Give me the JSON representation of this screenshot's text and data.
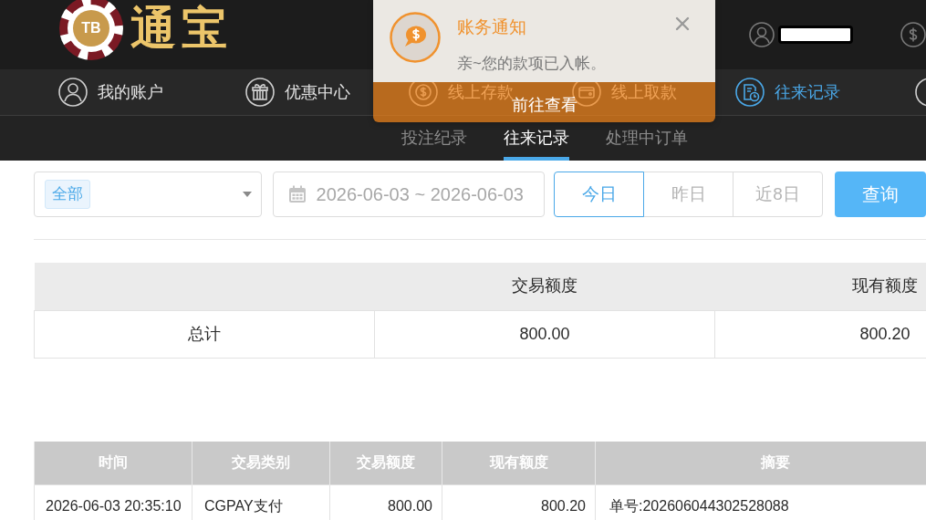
{
  "header": {
    "logo": {
      "badge": "TB",
      "name": "通宝"
    }
  },
  "nav_items": [
    {
      "label": "我的账户",
      "selected": false
    },
    {
      "label": "优惠中心",
      "selected": false
    },
    {
      "label": "线上存款",
      "selected": false
    },
    {
      "label": "线上取款",
      "selected": false
    },
    {
      "label": "往来记录",
      "selected": true
    }
  ],
  "sub_tabs": [
    {
      "label": "投注纪录",
      "selected": false
    },
    {
      "label": "往来记录",
      "selected": true
    },
    {
      "label": "处理中订单",
      "selected": false
    }
  ],
  "filters": {
    "type_select": {
      "tag": "全部"
    },
    "date_range": {
      "value": "2026-06-03 ~ 2026-06-03"
    },
    "quick_ranges": [
      {
        "label": "今日",
        "selected": true
      },
      {
        "label": "昨日",
        "selected": false
      },
      {
        "label": "近8日",
        "selected": false
      }
    ],
    "query_button": "查询"
  },
  "summary_table": {
    "columns": [
      "",
      "交易额度",
      "现有额度"
    ],
    "rows": [
      [
        "总计",
        "800.00",
        "800.20"
      ]
    ]
  },
  "records_table": {
    "columns": [
      "时间",
      "交易类别",
      "交易额度",
      "现有额度",
      "摘要"
    ],
    "rows": [
      [
        "2026-06-03 20:35:10",
        "CGPAY支付",
        "800.00",
        "800.20",
        "单号:202606044302528088"
      ]
    ]
  },
  "notification": {
    "title": "账务通知",
    "message": "亲~您的款项已入帐。",
    "action": "前往查看"
  }
}
